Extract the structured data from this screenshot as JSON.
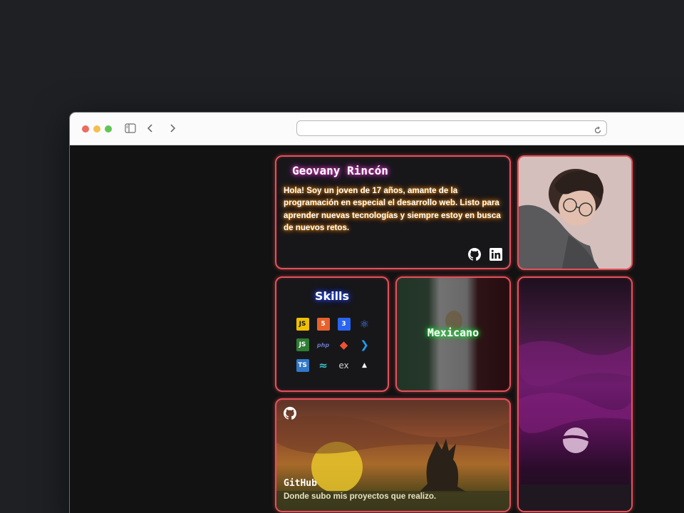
{
  "browser": {
    "url": "",
    "icons": [
      "sidebar-icon",
      "back-icon",
      "forward-icon",
      "reload-icon"
    ]
  },
  "profile": {
    "name": "Geovany Rincón",
    "bio": "Hola! Soy un joven de 17 años, amante de la programación en especial el desarrollo web. Listo para aprender nuevas tecnologías y siempre estoy en busca de nuevos retos.",
    "social_icons": [
      "github-icon",
      "linkedin-icon"
    ]
  },
  "skills": {
    "title": "Skills",
    "items": [
      {
        "name": "javascript-icon",
        "glyph": "JS",
        "bg": "#f0c000",
        "fg": "#1a1a1a"
      },
      {
        "name": "html5-icon",
        "glyph": "5",
        "bg": "#e8612c",
        "fg": "#fff"
      },
      {
        "name": "css3-icon",
        "glyph": "3",
        "bg": "#2965f1",
        "fg": "#fff"
      },
      {
        "name": "react-icon",
        "glyph": "⚛",
        "bg": "transparent",
        "fg": "#4e7ef5"
      },
      {
        "name": "nodejs-icon",
        "glyph": "JS",
        "bg": "#2f7d32",
        "fg": "#fff"
      },
      {
        "name": "php-icon",
        "glyph": "php",
        "bg": "transparent",
        "fg": "#6b78c4"
      },
      {
        "name": "git-icon",
        "glyph": "◆",
        "bg": "transparent",
        "fg": "#f05033"
      },
      {
        "name": "vscode-icon",
        "glyph": "❯",
        "bg": "transparent",
        "fg": "#1f9cf0"
      },
      {
        "name": "typescript-icon",
        "glyph": "TS",
        "bg": "#3178c6",
        "fg": "#fff"
      },
      {
        "name": "tailwind-icon",
        "glyph": "≈",
        "bg": "transparent",
        "fg": "#3bc2c9"
      },
      {
        "name": "express-icon",
        "glyph": "ex",
        "bg": "transparent",
        "fg": "#cfcfcf"
      },
      {
        "name": "astro-icon",
        "glyph": "▲",
        "bg": "transparent",
        "fg": "#ffffff"
      }
    ]
  },
  "nationality": {
    "label": "Mexicano"
  },
  "github_card": {
    "title": "GitHub",
    "description": "Donde subo mis proyectos que realizo."
  }
}
